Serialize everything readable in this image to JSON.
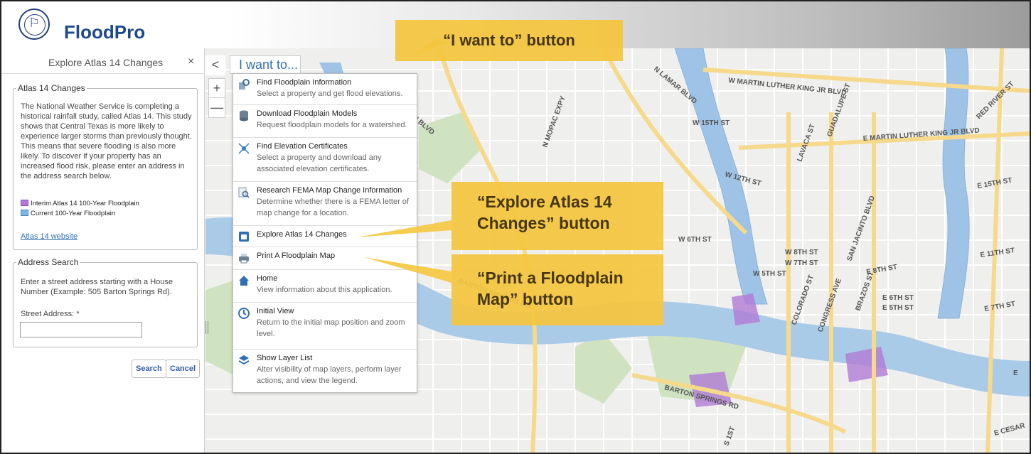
{
  "header": {
    "app_title": "FloodPro"
  },
  "panel": {
    "title": "Explore Atlas 14 Changes",
    "close_glyph": "×",
    "atlas_section": {
      "legend": "Atlas 14 Changes",
      "description": "The National Weather Service is completing a historical rainfall study, called Atlas 14. This study shows that Central Texas is more likely to experience larger storms than previously thought. This means that severe flooding is also more likely. To discover if your property has an increased flood risk, please enter an address in the address search below.",
      "legend_items": [
        {
          "label": "Interim Atlas 14 100-Year Floodplain",
          "color": "#b07ad6"
        },
        {
          "label": "Current 100-Year Floodplain",
          "color": "#7fb6e6"
        }
      ],
      "link": "Atlas 14 website"
    },
    "address_section": {
      "legend": "Address Search",
      "instructions": "Enter a street address starting with a House Number (Example: 505 Barton Springs Rd).",
      "street_label": "Street Address: *",
      "street_value": ""
    },
    "buttons": {
      "search": "Search",
      "cancel": "Cancel"
    }
  },
  "map_controls": {
    "collapse": "<",
    "zoom_in": "+",
    "zoom_out": "—"
  },
  "i_want_to": {
    "label": "I want to...",
    "items": [
      {
        "icon": "building-search-icon",
        "title": "Find Floodplain Information",
        "desc": "Select a property and get flood elevations."
      },
      {
        "icon": "database-download-icon",
        "title": "Download Floodplain Models",
        "desc": "Request floodplain models for a watershed."
      },
      {
        "icon": "elevation-certificate-icon",
        "title": "Find Elevation Certificates",
        "desc": "Select a property and download any associated elevation certificates."
      },
      {
        "icon": "document-search-icon",
        "title": "Research FEMA Map Change Information",
        "desc": "Determine whether there is a FEMA letter of map change for a location."
      },
      {
        "icon": "atlas-book-icon",
        "title": "Explore Atlas 14 Changes",
        "desc": ""
      },
      {
        "icon": "printer-icon",
        "title": "Print A Floodplain Map",
        "desc": ""
      },
      {
        "icon": "home-icon",
        "title": "Home",
        "desc": "View information about this application."
      },
      {
        "icon": "initial-view-icon",
        "title": "Initial View",
        "desc": "Return to the initial map position and zoom level."
      },
      {
        "icon": "layers-icon",
        "title": "Show Layer List",
        "desc": "Alter visibility of map layers, perform layer actions, and view the legend."
      }
    ]
  },
  "callouts": {
    "i_want_to": "“I want to” button",
    "explore_atlas": [
      "“Explore Atlas 14",
      "Changes” button"
    ],
    "print_map": [
      "“Print a Floodplain",
      "Map” button"
    ]
  },
  "map_labels": [
    "W MARTIN LUTHER KING JR BLVD",
    "E MARTIN LUTHER KING JR BLVD",
    "N MOPAC EXPY",
    "LAKE AUSTIN BLVD",
    "N LAMAR BLVD",
    "W 15TH ST",
    "W 12TH ST",
    "W 6TH ST",
    "W 8TH ST",
    "W 7TH ST",
    "W 5TH ST",
    "GUADALUPE ST",
    "LAVACA ST",
    "SAN JACINTO BLVD",
    "COLORADO ST",
    "CONGRESS AVE",
    "BRAZOS ST",
    "E 6TH ST",
    "E 5TH ST",
    "E 8TH ST",
    "E 11TH ST",
    "E 15TH ST",
    "E 7TH ST",
    "RED RIVER ST",
    "BARTON SPRINGS RD",
    "BARTON SPRINGS RD",
    "E CESAR",
    "E",
    "S 1ST"
  ]
}
